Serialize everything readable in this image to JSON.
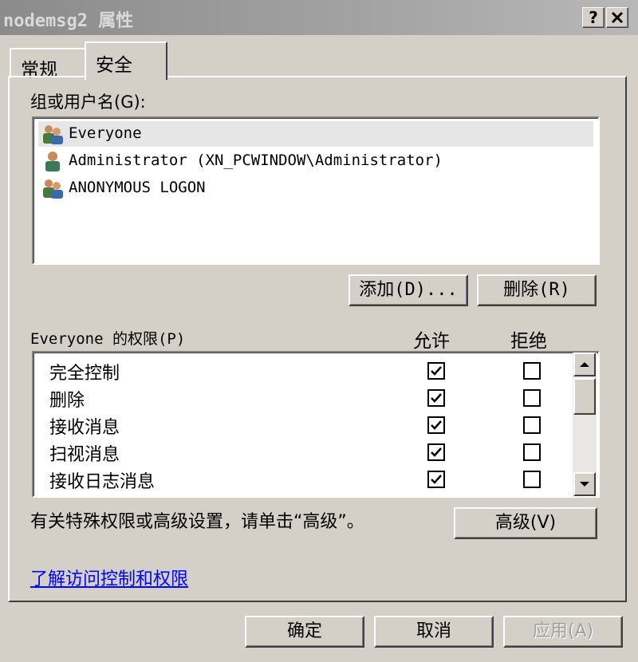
{
  "window": {
    "title": "nodemsg2 属性",
    "help_label": "?",
    "close_label": "✕"
  },
  "tabs": [
    {
      "label": "常规",
      "active": false
    },
    {
      "label": "安全",
      "active": true
    }
  ],
  "groups": {
    "label": "组或用户名(G):",
    "users": [
      {
        "name": "Everyone",
        "icon": "group-icon",
        "selected": true
      },
      {
        "name": "Administrator (XN_PCWINDOW\\Administrator)",
        "icon": "user-icon",
        "selected": false
      },
      {
        "name": "ANONYMOUS LOGON",
        "icon": "group-icon",
        "selected": false
      }
    ],
    "add_label": "添加(D)...",
    "remove_label": "删除(R)"
  },
  "permissions": {
    "label": "Everyone 的权限(P)",
    "allow_header": "允许",
    "deny_header": "拒绝",
    "rows": [
      {
        "name": "完全控制",
        "allow": true,
        "deny": false
      },
      {
        "name": "删除",
        "allow": true,
        "deny": false
      },
      {
        "name": "接收消息",
        "allow": true,
        "deny": false
      },
      {
        "name": "扫视消息",
        "allow": true,
        "deny": false
      },
      {
        "name": "接收日志消息",
        "allow": true,
        "deny": false
      }
    ]
  },
  "advanced": {
    "text": "有关特殊权限或高级设置，请单击“高级”。",
    "button_label": "高级(V)"
  },
  "help_link": "了解访问控制和权限",
  "footer": {
    "ok_label": "确定",
    "cancel_label": "取消",
    "apply_label": "应用(A)"
  }
}
